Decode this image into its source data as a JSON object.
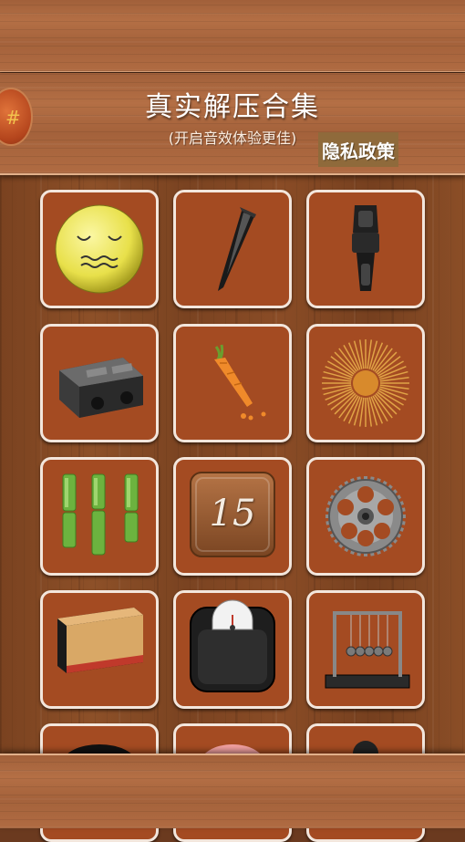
{
  "header": {
    "title": "真实解压合集",
    "subtitle": "(开启音效体验更佳)",
    "privacy_label": "隐私政策"
  },
  "grid": {
    "items": [
      {
        "id": "face",
        "icon": "yellow-face-icon"
      },
      {
        "id": "brush",
        "icon": "brush-icon"
      },
      {
        "id": "zipper",
        "icon": "zipper-icon"
      },
      {
        "id": "sharpener",
        "icon": "pencil-sharpener-icon"
      },
      {
        "id": "carrot",
        "icon": "carrot-icon"
      },
      {
        "id": "sunburst",
        "icon": "sunburst-icon"
      },
      {
        "id": "bamboo",
        "icon": "bamboo-icon"
      },
      {
        "id": "puzzle15",
        "icon": "number-15-block-icon",
        "label": "15"
      },
      {
        "id": "gear",
        "icon": "gear-icon"
      },
      {
        "id": "eraser",
        "icon": "eraser-block-icon"
      },
      {
        "id": "scale",
        "icon": "weighing-scale-icon"
      },
      {
        "id": "newton",
        "icon": "newtons-cradle-icon"
      }
    ]
  },
  "colors": {
    "tile_bg": "#a44b22",
    "tile_border": "#f3e6dc",
    "privacy_bg": "#8f6a3b"
  }
}
